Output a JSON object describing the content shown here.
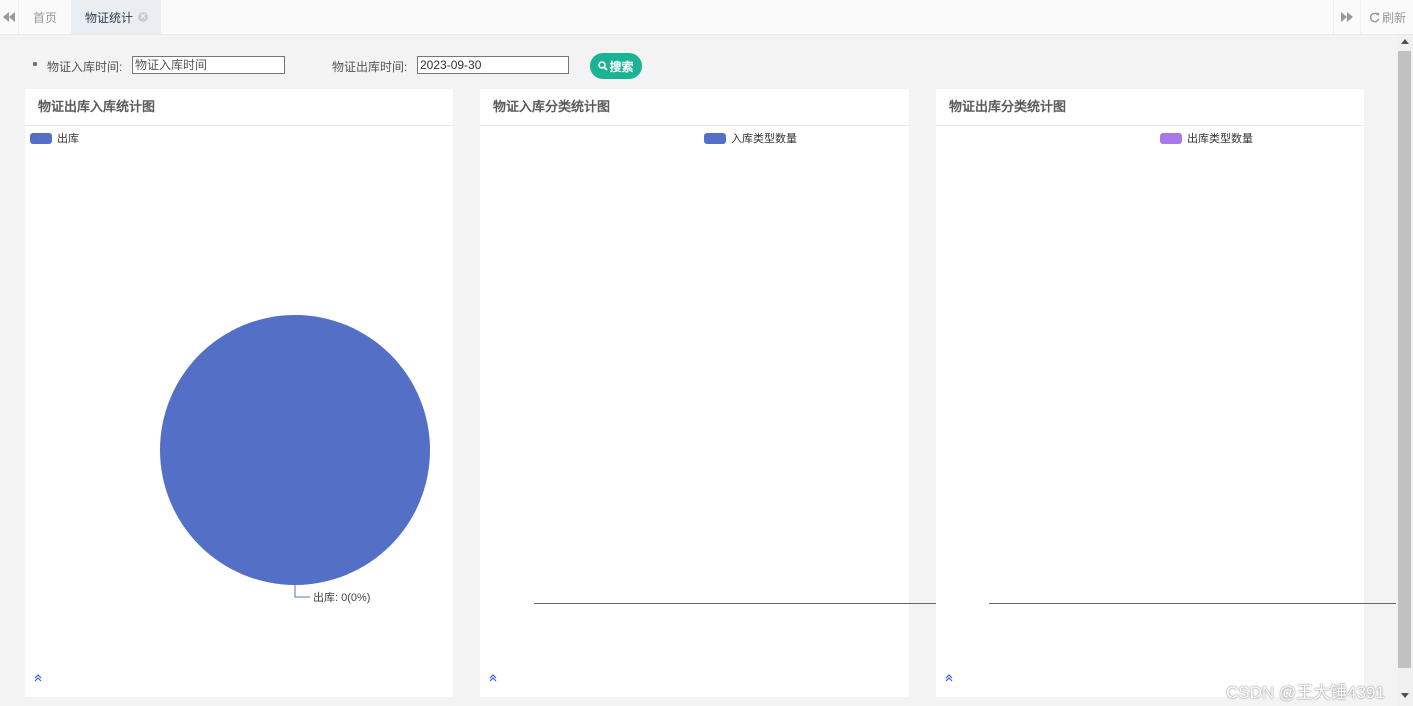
{
  "tabs": {
    "home": "首页",
    "active": "物证统计",
    "refresh": "刷新"
  },
  "search": {
    "in_label": "物证入库时间:",
    "in_placeholder": "物证入库时间",
    "in_value": "",
    "out_label": "物证出库时间:",
    "out_value": "2023-09-30",
    "button": "搜索"
  },
  "panels": [
    {
      "title": "物证出库入库统计图",
      "legend": "出库",
      "legend_color": "#5470c6"
    },
    {
      "title": "物证入库分类统计图",
      "legend": "入库类型数量",
      "legend_color": "#5470c6"
    },
    {
      "title": "物证出库分类统计图",
      "legend": "出库类型数量",
      "legend_color": "#a77ae8"
    }
  ],
  "chart_data": {
    "type": "pie",
    "categories": [
      "出库"
    ],
    "values": [
      0
    ],
    "colors": [
      "#5470c6"
    ],
    "data_labels": [
      "出库: 0(0%)"
    ],
    "legend": [
      "出库"
    ]
  },
  "watermark": "CSDN @王大锤4391",
  "icons": {
    "left": "double-left-arrow-icon",
    "right": "double-right-arrow-icon",
    "refresh": "refresh-icon",
    "search": "search-icon",
    "collapse": "double-up-arrow-icon"
  }
}
